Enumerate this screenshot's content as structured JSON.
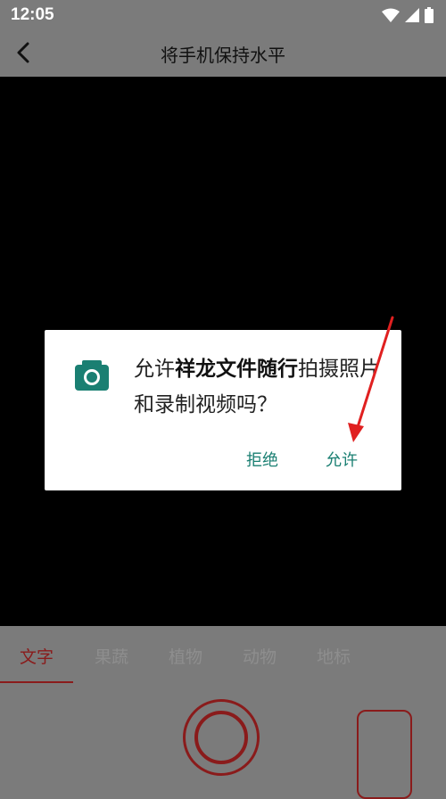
{
  "status_bar": {
    "time": "12:05",
    "icons": [
      "wifi-icon",
      "signal-icon",
      "battery-icon"
    ]
  },
  "header": {
    "title": "将手机保持水平",
    "back_icon": "chevron-left-icon"
  },
  "dialog": {
    "icon": "camera-icon",
    "message_prefix": "允许",
    "app_name": "祥龙文件随行",
    "message_suffix": "拍摄照片和录制视频吗？",
    "deny_label": "拒绝",
    "allow_label": "允许"
  },
  "mode_tabs": {
    "items": [
      {
        "label": "文字",
        "active": true
      },
      {
        "label": "果蔬",
        "active": false
      },
      {
        "label": "植物",
        "active": false
      },
      {
        "label": "动物",
        "active": false
      },
      {
        "label": "地标",
        "active": false
      }
    ]
  },
  "colors": {
    "accent": "#8a1b1b",
    "dialog_button": "#1a7f72",
    "annotation_arrow": "#e02020",
    "overlay_gray": "#7b7b7b"
  }
}
